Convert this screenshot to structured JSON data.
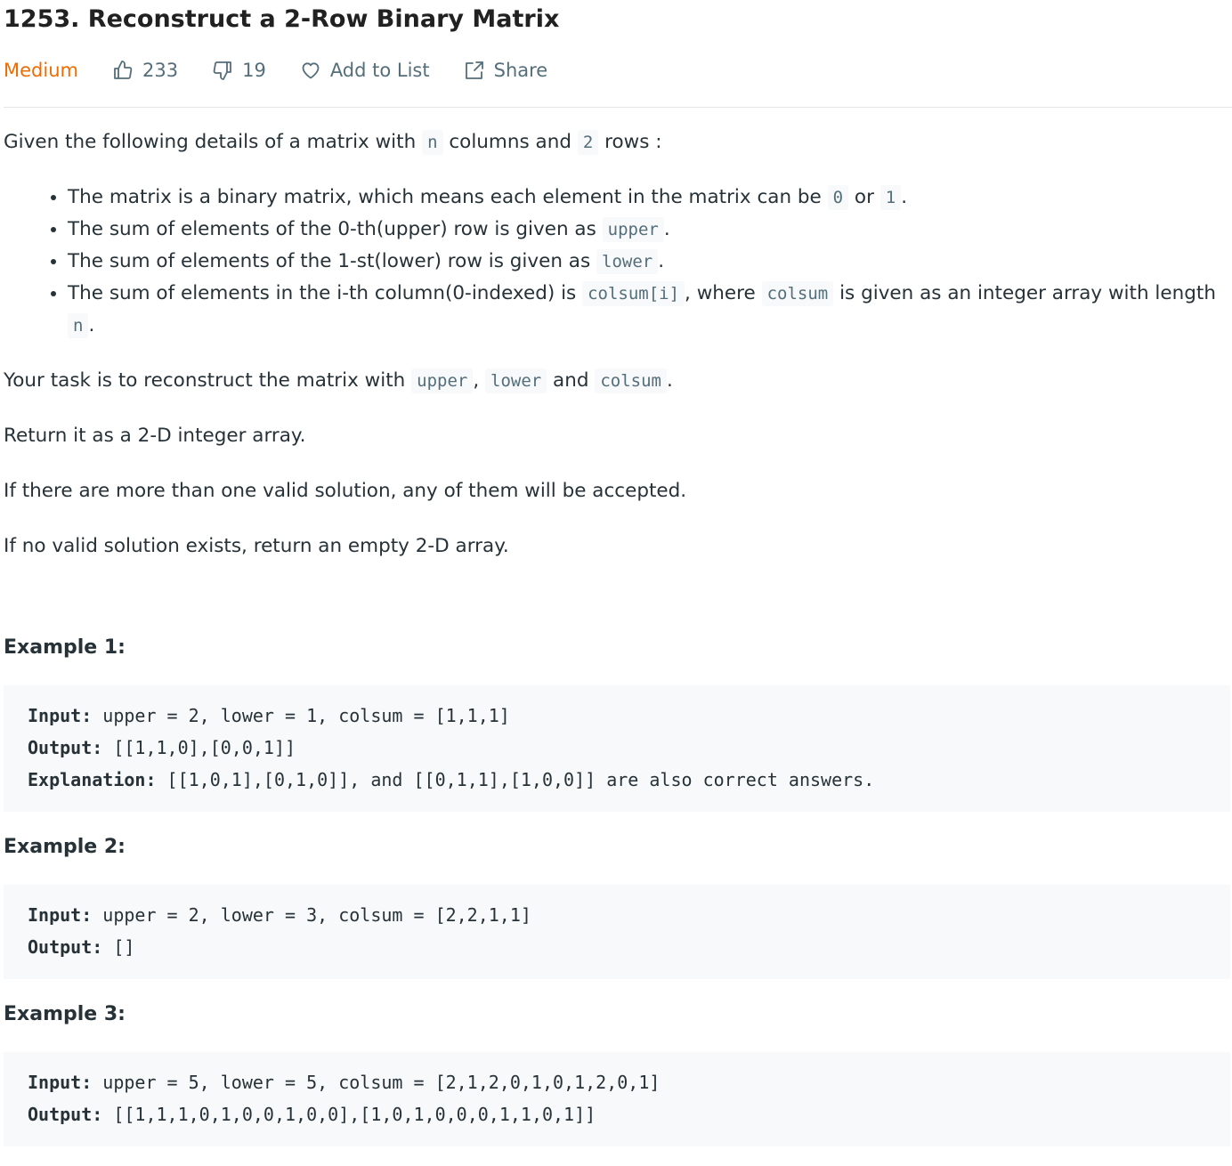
{
  "problem": {
    "title": "1253. Reconstruct a 2-Row Binary Matrix",
    "difficulty": "Medium",
    "likes": "233",
    "dislikes": "19",
    "add_to_list": "Add to List",
    "share": "Share"
  },
  "description": {
    "p1_a": "Given the following details of a matrix with ",
    "p1_code1": "n",
    "p1_b": " columns and ",
    "p1_code2": "2",
    "p1_c": " rows :",
    "bullets": [
      {
        "a": "The matrix is a binary matrix, which means each element in the matrix can be ",
        "code1": "0",
        "b": " or ",
        "code2": "1",
        "c": "."
      },
      {
        "a": "The sum of elements of the 0-th(upper) row is given as ",
        "code1": "upper",
        "b": "."
      },
      {
        "a": "The sum of elements of the 1-st(lower) row is given as ",
        "code1": "lower",
        "b": "."
      },
      {
        "a": "The sum of elements in the i-th column(0-indexed) is ",
        "code1": "colsum[i]",
        "b": ", where ",
        "code2": "colsum",
        "c": " is given as an integer array with length ",
        "code3": "n",
        "d": "."
      }
    ],
    "p2_a": "Your task is to reconstruct the matrix with ",
    "p2_code1": "upper",
    "p2_b": ", ",
    "p2_code2": "lower",
    "p2_c": " and ",
    "p2_code3": "colsum",
    "p2_d": ".",
    "p3": "Return it as a 2-D integer array.",
    "p4": "If there are more than one valid solution, any of them will be accepted.",
    "p5": "If no valid solution exists, return an empty 2-D array."
  },
  "examples": [
    {
      "title": "Example 1:",
      "input_label": "Input:",
      "input": " upper = 2, lower = 1, colsum = [1,1,1]",
      "output_label": "Output:",
      "output": " [[1,1,0],[0,0,1]]",
      "explanation_label": "Explanation:",
      "explanation": " [[1,0,1],[0,1,0]], and [[0,1,1],[1,0,0]] are also correct answers."
    },
    {
      "title": "Example 2:",
      "input_label": "Input:",
      "input": " upper = 2, lower = 3, colsum = [2,2,1,1]",
      "output_label": "Output:",
      "output": " []"
    },
    {
      "title": "Example 3:",
      "input_label": "Input:",
      "input": " upper = 5, lower = 5, colsum = [2,1,2,0,1,0,1,2,0,1]",
      "output_label": "Output:",
      "output": " [[1,1,1,0,1,0,0,1,0,0],[1,0,1,0,0,0,1,1,0,1]]"
    }
  ],
  "colors": {
    "difficulty_medium": "#ef6c00",
    "text": "#263238",
    "meta": "#546e7a",
    "code_bg": "#f7f9fa"
  },
  "icons": [
    "thumbs-up-icon",
    "thumbs-down-icon",
    "heart-icon",
    "share-icon"
  ]
}
